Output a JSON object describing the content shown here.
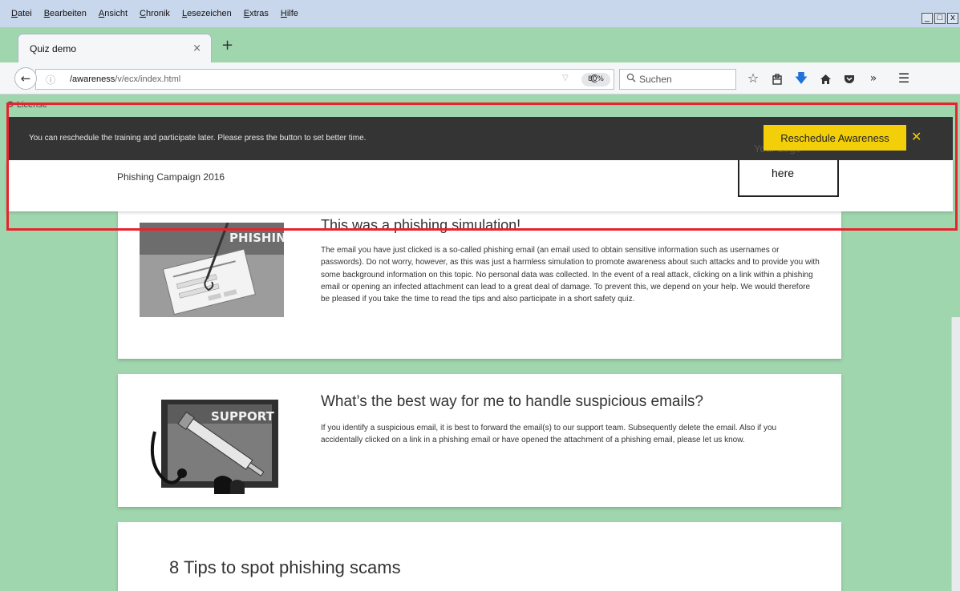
{
  "menu": [
    "Datei",
    "Bearbeiten",
    "Ansicht",
    "Chronik",
    "Lesezeichen",
    "Extras",
    "Hilfe"
  ],
  "window_controls": [
    "_",
    "□",
    "x"
  ],
  "tab": {
    "title": "Quiz demo",
    "close": "×",
    "new_tab": "+"
  },
  "nav": {
    "back": "←",
    "info": "ⓘ",
    "url_host": "/awareness",
    "url_path": "/v/ecx/index.html",
    "dropdown": "▽",
    "zoom": "80%",
    "reload": "C",
    "search_placeholder": "Suchen",
    "icons": [
      "star-icon",
      "bookmarks-icon",
      "download-icon",
      "home-icon",
      "pocket-icon",
      "overflow-icon",
      "menu-icon"
    ]
  },
  "page": {
    "license": "License",
    "campaign": "Phishing Campaign 2016",
    "logo_line1": "Your Logo",
    "logo_line2": "here"
  },
  "notification": {
    "message": "You can reschedule the training and participate later. Please press the button to set better time.",
    "button": "Reschedule Awareness",
    "close": "✕",
    "bar_color": "#343434",
    "button_color": "#f3cf0a"
  },
  "cards": [
    {
      "title": "This was a phishing simulation!",
      "body": "The email you have just clicked is a so-called phishing email (an email used to obtain sensitive information such as usernames or passwords). Do not worry, however, as this was just a harmless simulation to promote awareness about such attacks and to provide you with some background information on this topic. No personal data was collected. In the event of a real attack, clicking on a link within a phishing email or opening an infected attachment can lead to a great deal of damage. To prevent this, we depend on your help. We would therefore be pleased if you take the time to read the tips and also participate in a short safety quiz.",
      "image_label": "PHISHING"
    },
    {
      "title": "What’s the best way for me to handle suspicious emails?",
      "body": "If you identify a suspicious email, it is best to forward the email(s) to our support team. Subsequently delete the email. Also if you accidentally clicked on a link in a phishing email or have opened the attachment of a phishing email, please let us know.",
      "image_label": "SUPPORT"
    },
    {
      "title": "8 Tips to spot phishing scams"
    }
  ],
  "colors": {
    "page_bg": "#9fd6ad",
    "highlight": "#e8232f",
    "menubar": "#c8d7ec"
  }
}
